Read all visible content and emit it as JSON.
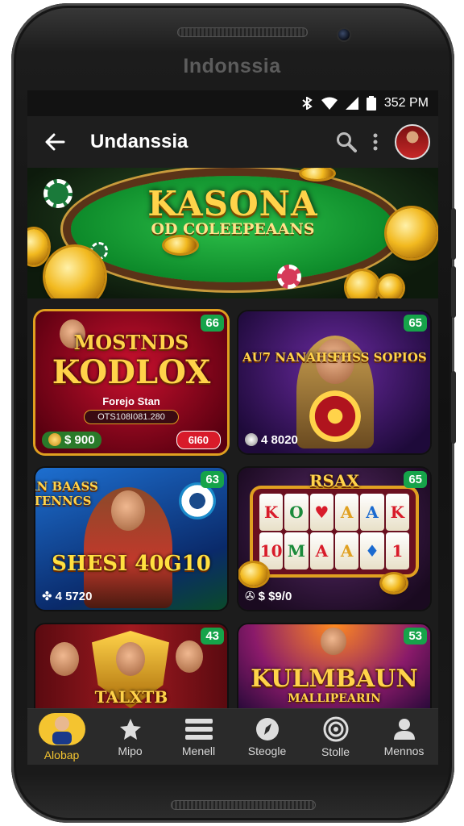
{
  "device": {
    "bezel_label": "Indonssia"
  },
  "statusbar": {
    "time": "352 PM",
    "icons": [
      "bluetooth-icon",
      "wifi-icon",
      "signal-icon",
      "battery-icon"
    ]
  },
  "appbar": {
    "title": "Undanssia",
    "icons": {
      "back": "arrow-left-icon",
      "search": "search-icon",
      "more": "more-vert-icon"
    }
  },
  "hero": {
    "title": "KASONA",
    "subtitle": "OD COLEEPEAANS"
  },
  "games": [
    {
      "title": "MOSTNDS",
      "title2": "KODLOX",
      "subtitle": "Forejo Stan",
      "code": "OTS108I081.280",
      "price": "$ 900",
      "action_label": "6I60",
      "badge": "66"
    },
    {
      "title_left": "AU7 NANAHS",
      "title_right": "FHSS SOPIOS",
      "price": "4 8020",
      "badge": "65"
    },
    {
      "title": "WIORN BAASS SANTENNCS",
      "title2": "SHESI 40G10",
      "price": "4 5720",
      "badge": "63"
    },
    {
      "title": "RSAX",
      "reels": [
        "K",
        "O",
        "♥",
        "A",
        "A",
        "K",
        "10",
        "M",
        "A",
        "A",
        "♦",
        "1"
      ],
      "price": "$ $9/0",
      "badge": "65"
    },
    {
      "title": "TALXTB",
      "badge": "43"
    },
    {
      "title": "KULMBAUN",
      "subtitle": "MALLIPEARIN",
      "badge": "53"
    }
  ],
  "bottomnav": [
    {
      "label": "Alobap",
      "icon": "home-avatar-icon",
      "active": true
    },
    {
      "label": "Mipo",
      "icon": "puzzle-icon",
      "active": false
    },
    {
      "label": "Menell",
      "icon": "menu-list-icon",
      "active": false
    },
    {
      "label": "Steogle",
      "icon": "compass-icon",
      "active": false
    },
    {
      "label": "Stolle",
      "icon": "target-icon",
      "active": false
    },
    {
      "label": "Mennos",
      "icon": "person-icon",
      "active": false
    }
  ],
  "colors": {
    "accent": "#f4c430",
    "badge": "#16a34a",
    "table": "#1faa3c"
  }
}
